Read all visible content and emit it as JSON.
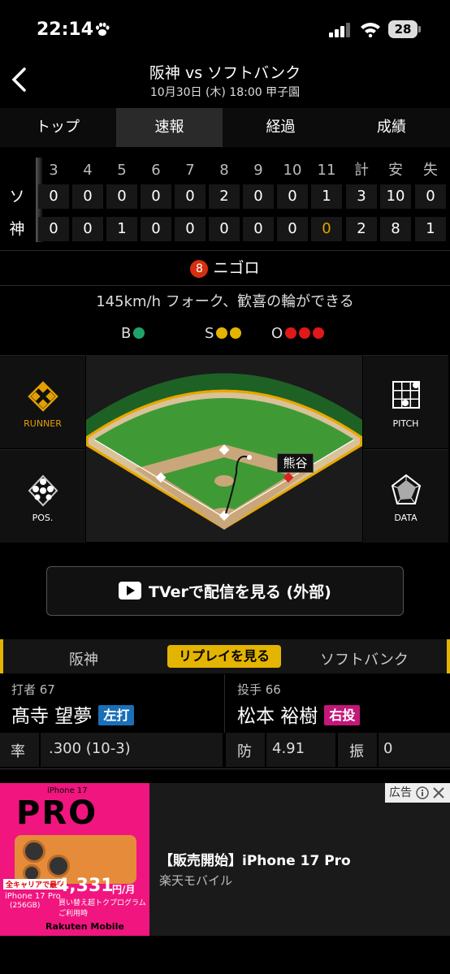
{
  "status_bar": {
    "time": "22:14",
    "battery": "28"
  },
  "header": {
    "title": "阪神 vs ソフトバンク",
    "subtitle": "10月30日 (木) 18:00 甲子園"
  },
  "tabs": [
    "トップ",
    "速報",
    "経過",
    "成績"
  ],
  "scoreboard": {
    "headers": [
      "3",
      "4",
      "5",
      "6",
      "7",
      "8",
      "9",
      "10",
      "11",
      "計",
      "安",
      "失"
    ],
    "rows": [
      {
        "team": "ソ",
        "cells": [
          "0",
          "0",
          "0",
          "0",
          "0",
          "2",
          "0",
          "0",
          "1",
          "3",
          "10",
          "0"
        ]
      },
      {
        "team": "神",
        "cells": [
          "0",
          "0",
          "1",
          "0",
          "0",
          "0",
          "0",
          "0",
          "0",
          "2",
          "8",
          "1"
        ]
      }
    ],
    "highlight_color": "#e3a000"
  },
  "play": {
    "position_number": "8",
    "result": "ニゴロ",
    "description": "145km/h フォーク、歓喜の輪ができる"
  },
  "count": {
    "balls_label": "B",
    "strikes_label": "S",
    "outs_label": "O",
    "balls": 1,
    "strikes": 2,
    "outs": 3
  },
  "side_buttons": {
    "runner": "RUNNER",
    "pitch": "PITCH",
    "pos": "POS.",
    "data": "DATA"
  },
  "field": {
    "fielder_name": "熊谷"
  },
  "tver_button": "TVerで配信を見る (外部)",
  "replay": {
    "left_team": "阪神",
    "button": "リプレイを見る",
    "right_team": "ソフトバンク"
  },
  "batter": {
    "label": "打者 67",
    "name": "髙寺 望夢",
    "badge": "左打",
    "badge_color": "#1a6fb8"
  },
  "pitcher": {
    "label": "投手 66",
    "name": "松本 裕樹",
    "badge": "右投",
    "badge_color": "#c2187a"
  },
  "stats": {
    "batter_key": "率",
    "batter_value": ".300 (10-3)",
    "pitcher_era_key": "防",
    "pitcher_era_value": "4.91",
    "pitcher_k_key": "振",
    "pitcher_k_value": "0"
  },
  "ad": {
    "tag": "広告",
    "title": "【販売開始】iPhone 17 Pro",
    "advertiser": "楽天モバイル",
    "img_brand": "iPhone 17",
    "img_pro": "PRO",
    "img_price": "4,331",
    "img_price_unit": "円/月",
    "img_model": "iPhone 17 Pro",
    "img_storage": "(256GB)",
    "img_tagline": "全キャリアで最安",
    "img_program": "買い替え超トクプログラムご利用時",
    "img_logo": "Rakuten Mobile"
  }
}
